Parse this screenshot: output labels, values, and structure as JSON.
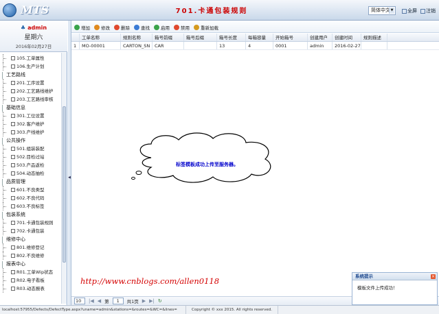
{
  "header": {
    "logo_text": "MTS",
    "title": "701.卡通包装规则",
    "language": "简体中文",
    "links": [
      "全屏",
      "注销"
    ]
  },
  "user": {
    "name": "admin",
    "weekday": "星期六",
    "date": "2016年02月27日"
  },
  "menu": [
    {
      "group": null,
      "items": [
        "105.工单属性",
        "106.生产计划"
      ]
    },
    {
      "group": "工艺路线",
      "items": [
        "201.工序设置",
        "202.工艺路线维护",
        "203.工艺路线审核"
      ]
    },
    {
      "group": "基础信息",
      "items": [
        "301.工位设置",
        "302.客户维护",
        "303.产线维护"
      ]
    },
    {
      "group": "公共操作",
      "items": [
        "501.组装装配",
        "502.目检过站",
        "503.产品返检",
        "504.动态抽检"
      ]
    },
    {
      "group": "品质管理",
      "items": [
        "601.不良类型",
        "602.不良代码",
        "603.不良标签"
      ]
    },
    {
      "group": "包装系统",
      "items": [
        "701.卡通包装规则",
        "702.卡通包装"
      ]
    },
    {
      "group": "维修中心",
      "items": [
        "801.维修登记",
        "802.不良维修"
      ]
    },
    {
      "group": "报表中心",
      "items": [
        "R01.工单Wip状态",
        "R02.电子看板",
        "R03.动态报表"
      ]
    }
  ],
  "toolbar": [
    "增加",
    "修改",
    "删除",
    "查找",
    "启用",
    "禁用",
    "重新加载"
  ],
  "grid": {
    "columns": [
      "",
      "工单名称",
      "规则名称",
      "箱号前缀",
      "箱号后缀",
      "箱号长度",
      "每箱容量",
      "开始箱号",
      "创建用户",
      "创建时间",
      "规则描述"
    ],
    "rows": [
      [
        "1",
        "MO-00001",
        "CARTON_SN",
        "CAR",
        "",
        "13",
        "4",
        "0001",
        "admin",
        "2016-02-27 1",
        ""
      ]
    ]
  },
  "pager": {
    "page_size": "10",
    "page_label": "第",
    "page": "1",
    "total": "共1页"
  },
  "cloud_message": "标签模板成功上传至服务器。",
  "watermark": "http://www.cnblogs.com/allen0118",
  "status": {
    "url": "localhost:57955/Defects/DefectType.aspx?uname=admin&stations=&routes=&WC=&lines=",
    "copyright": "Copyright © xxx 2015. All rights reserved."
  },
  "toast": {
    "title": "系统提示",
    "message": "模板文件上传成功！"
  },
  "colors": {
    "title_red": "#cc0000",
    "header_blue": "#c9d8ea",
    "cloud_text": "#0000cc"
  }
}
